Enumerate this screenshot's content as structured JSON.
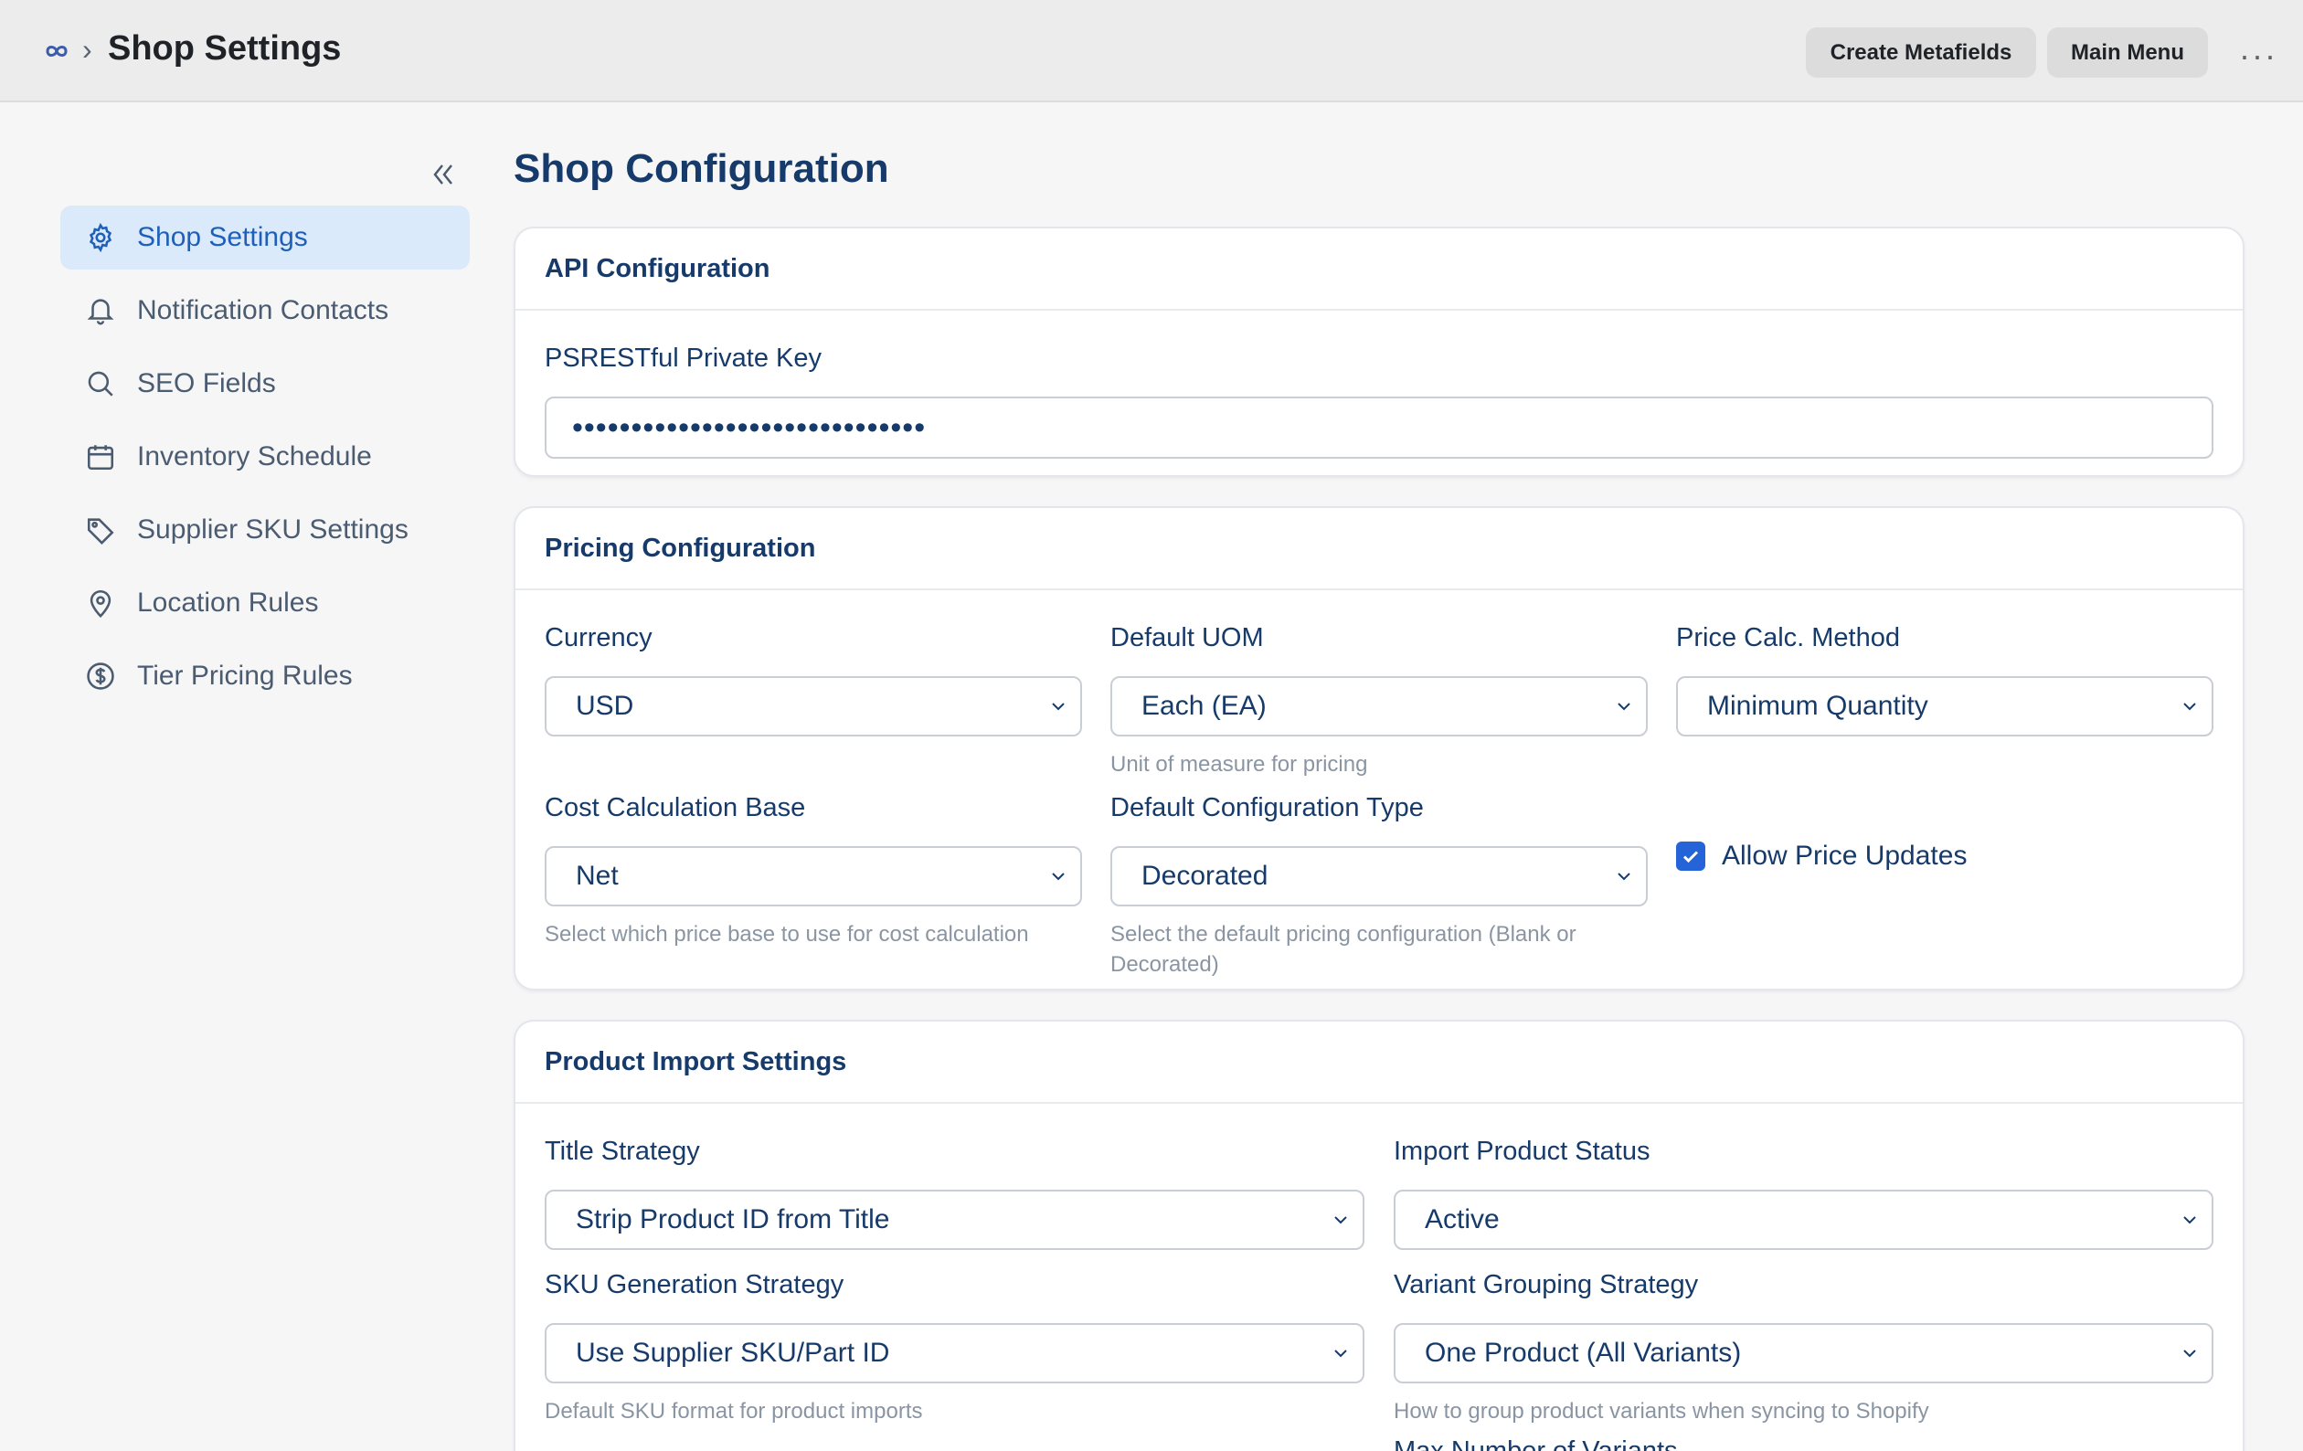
{
  "header": {
    "breadcrumb_separator": "›",
    "title": "Shop Settings",
    "create_metafields": "Create Metafields",
    "main_menu": "Main Menu",
    "more": "···"
  },
  "sidebar": {
    "collapse_icon": "double-chevron-left-icon",
    "items": [
      {
        "label": "Shop Settings",
        "icon": "gear-icon",
        "active": true
      },
      {
        "label": "Notification Contacts",
        "icon": "bell-icon"
      },
      {
        "label": "SEO Fields",
        "icon": "search-icon"
      },
      {
        "label": "Inventory Schedule",
        "icon": "calendar-icon"
      },
      {
        "label": "Supplier SKU Settings",
        "icon": "tag-icon"
      },
      {
        "label": "Location Rules",
        "icon": "map-pin-icon"
      },
      {
        "label": "Tier Pricing Rules",
        "icon": "dollar-circle-icon"
      }
    ]
  },
  "main": {
    "title": "Shop Configuration",
    "api": {
      "heading": "API Configuration",
      "key_label": "PSRESTful Private Key",
      "key_value": "••••••••••••••••••••••••••••••"
    },
    "pricing": {
      "heading": "Pricing Configuration",
      "currency_label": "Currency",
      "currency_value": "USD",
      "uom_label": "Default UOM",
      "uom_value": "Each (EA)",
      "uom_help": "Unit of measure for pricing",
      "method_label": "Price Calc. Method",
      "method_value": "Minimum Quantity",
      "cost_label": "Cost Calculation Base",
      "cost_value": "Net",
      "cost_help": "Select which price base to use for cost calculation",
      "config_label": "Default Configuration Type",
      "config_value": "Decorated",
      "config_help": "Select the default pricing configuration (Blank or Decorated)",
      "allow_label": "Allow Price Updates",
      "allow_checked": true
    },
    "import": {
      "heading": "Product Import Settings",
      "title_label": "Title Strategy",
      "title_value": "Strip Product ID from Title",
      "status_label": "Import Product Status",
      "status_value": "Active",
      "sku_label": "SKU Generation Strategy",
      "sku_value": "Use Supplier SKU/Part ID",
      "sku_help": "Default SKU format for product imports",
      "variant_label": "Variant Grouping Strategy",
      "variant_value": "One Product (All Variants)",
      "variant_help": "How to group product variants when syncing to Shopify",
      "max_label": "Max Number of Variants"
    }
  },
  "colors": {
    "accent": "#2563d8",
    "active_bg": "#dbeafb",
    "heading": "#163a6a"
  }
}
